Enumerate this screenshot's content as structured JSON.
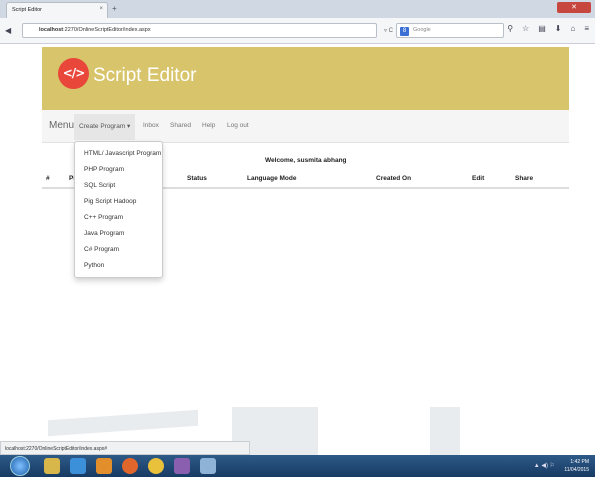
{
  "browser": {
    "tab_title": "Script Editor",
    "tab_close": "×",
    "new_tab": "+",
    "close_window": "✕",
    "back": "◀",
    "url_host": "localhost",
    "url_path": ":2270/OnlineScriptEditor/index.aspx",
    "url_icons": "▿ C",
    "search_engine_letter": "8",
    "search_placeholder": "Google",
    "tool_icons": [
      "⚲",
      "☆",
      "▤",
      "⬇",
      "⌂",
      "≡"
    ]
  },
  "header": {
    "logo_glyph": "</>",
    "brand": "Script Editor"
  },
  "menu": {
    "label": "Menu",
    "items": [
      {
        "label": "Create Program ▾"
      },
      {
        "label": "Inbox"
      },
      {
        "label": "Shared"
      },
      {
        "label": "Help"
      },
      {
        "label": "Log out"
      }
    ]
  },
  "welcome": "Welcome,  susmita abhang",
  "table": {
    "headers": [
      "#",
      "Pr",
      "Status",
      "Language Mode",
      "Created On",
      "Edit",
      "Share"
    ]
  },
  "dropdown": {
    "items": [
      "HTML/ Javascript Program",
      "PHP Program",
      "SQL Script",
      "Pig Script Hadoop",
      "C++ Program",
      "Java Program",
      "C# Program",
      "Python"
    ]
  },
  "statusbar": {
    "url": "localhost:2270/OnlineScriptEditor/index.aspx#"
  },
  "taskbar": {
    "time": "1:42 PM",
    "date": "11/04/2015",
    "tray": "▲ ◀) ⚐"
  }
}
